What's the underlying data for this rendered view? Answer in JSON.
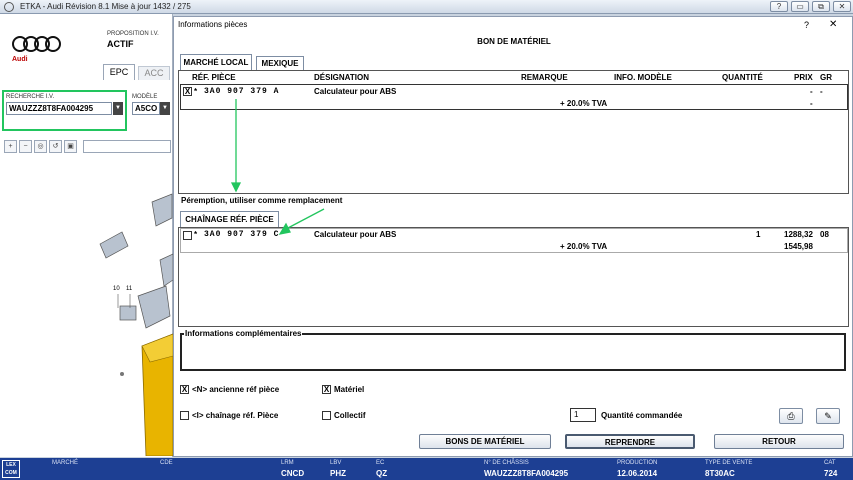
{
  "window": {
    "title": "ETKA - Audi Révision 8.1 Mise à jour 1432 / 275",
    "help_btn": "?",
    "min_btn": "▭",
    "restore_btn": "⧉",
    "close_btn": "✕"
  },
  "left": {
    "brand": "Audi",
    "proposition_label": "PROPOSITION I.V.",
    "proposition_value": "ACTIF",
    "tab_epc": "EPC",
    "tab_acc": "ACC",
    "search_label": "RECHERCHE I.V.",
    "search_value": "WAUZZZ8T8FA004295",
    "model_label": "MODÈLE",
    "model_value": "A5CO",
    "callout_1": "10",
    "callout_2": "11"
  },
  "dialog": {
    "title": "Informations pièces",
    "help": "?",
    "close": "✕",
    "heading": "BON DE MATÉRIEL",
    "tabs": [
      "MARCHÉ LOCAL",
      "MEXIQUE"
    ],
    "columns": {
      "ref": "RÉF. PIÈCE",
      "designation": "DÉSIGNATION",
      "remarque": "REMARQUE",
      "info_modele": "INFO. MODÈLE",
      "quantite": "QUANTITÉ",
      "prix": "PRIX",
      "gr": "GR"
    },
    "main_row": {
      "checkbox": "X",
      "marker": "*",
      "ref": "3A0 907 379 A",
      "designation": "Calculateur pour ABS",
      "tva": "+ 20.0% TVA",
      "prix": "-",
      "gr": "-",
      "prix_tva": "-"
    },
    "peremption_title": "Péremption, utiliser comme remplacement",
    "chain_tab": "CHAÎNAGE RÉF. PIÈCE",
    "chain_row": {
      "marker": "*",
      "ref": "3A0 907 379 C",
      "designation": "Calculateur pour ABS",
      "quantite": "1",
      "prix": "1288,32",
      "gr": "08",
      "tva": "+ 20.0% TVA",
      "prix_tva": "1545,98"
    },
    "info_comp_title": "Informations complémentaires",
    "options": {
      "old_ref": "<N> ancienne réf pièce",
      "materiel": "Matériel",
      "chain_ref": "<I> chaînage réf. Pièce",
      "collectif": "Collectif"
    },
    "qty_value": "1",
    "qty_label": "Quantité commandée",
    "buttons": {
      "bons": "BONS DE MATÉRIEL",
      "reprendre": "REPRENDRE",
      "retour": "RETOUR"
    },
    "icons": [
      "printer-icon",
      "edit-icon"
    ]
  },
  "status": {
    "logo": "LEX COM",
    "marche_label": "MARCHÉ",
    "cde_label": "CDE",
    "lrm_label": "LRM",
    "lrm_value": "CNCD",
    "lbv_label": "LBV",
    "lbv_value": "PHZ",
    "ec_label": "EC",
    "ec_value": "QZ",
    "chassis_label": "N° DE CHÂSSIS",
    "chassis_value": "WAUZZZ8T8FA004295",
    "production_label": "PRODUCTION",
    "production_value": "12.06.2014",
    "type_label": "TYPE DE VENTE",
    "type_value": "8T30AC",
    "cat_label": "CAT",
    "cat_value": "724"
  },
  "colors": {
    "accent_green": "#22c55e",
    "status_blue": "#1d3f93",
    "part_yellow": "#e8b400"
  }
}
